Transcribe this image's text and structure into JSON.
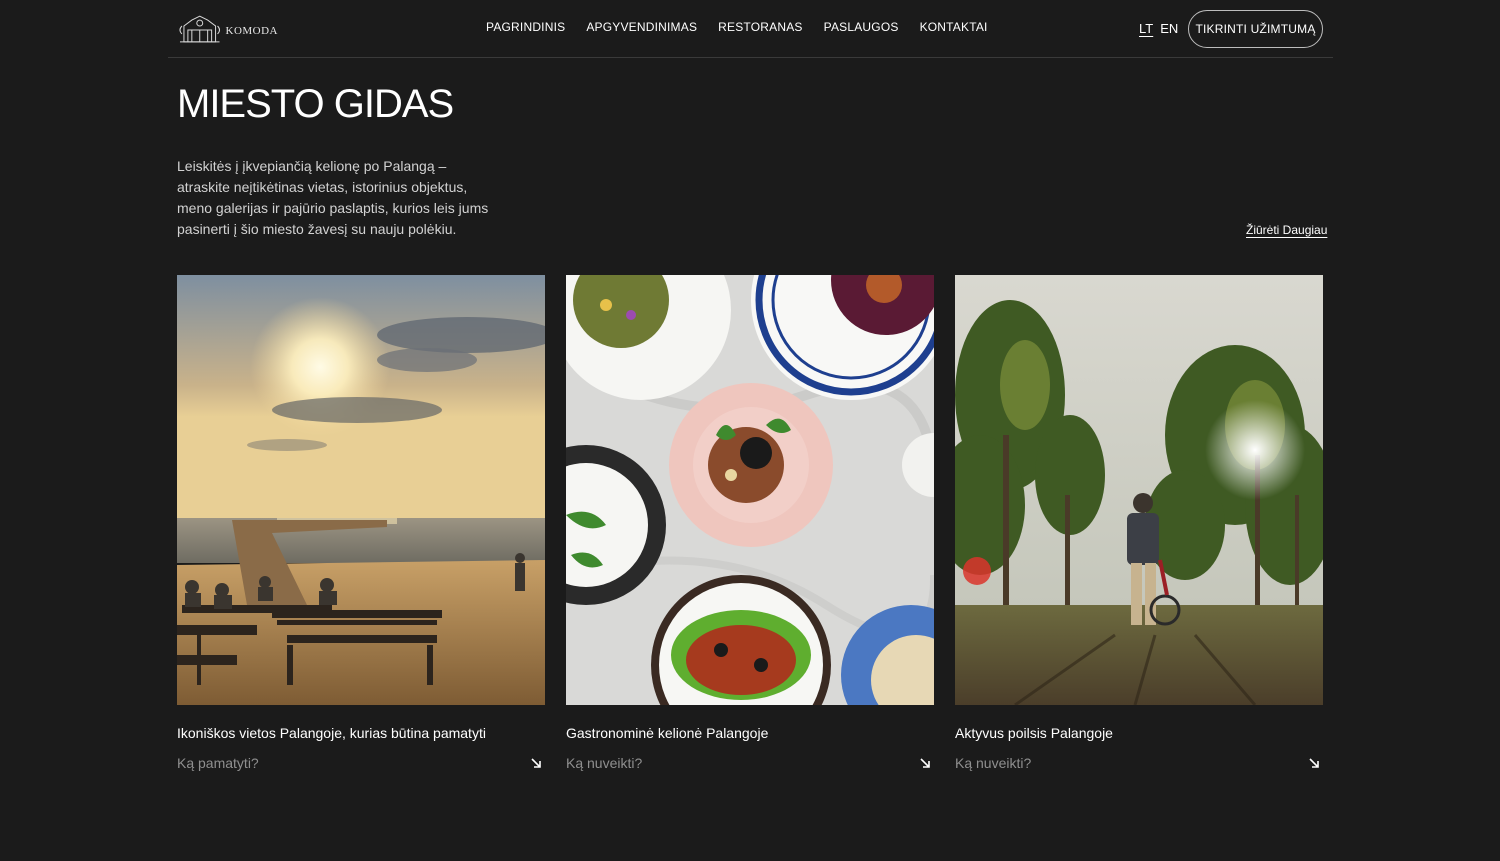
{
  "header": {
    "logo_text": "KOMODA",
    "nav": [
      "PAGRINDINIS",
      "APGYVENDINIMAS",
      "RESTORANAS",
      "PASLAUGOS",
      "KONTAKTAI"
    ],
    "lang": [
      "LT",
      "EN"
    ],
    "cta": "TIKRINTI UŽIMTUMĄ"
  },
  "main": {
    "title": "MIESTO GIDAS",
    "intro": "Leiskitės į įkvepiančią kelionę po Palangą – atraskite neįtikėtinas vietas, istorinius objektus, meno galerijas ir pajūrio paslaptis, kurios leis jums pasinerti į šio miesto žavesį su nauju polėkiu.",
    "see_more": "Žiūrėti Daugiau"
  },
  "cards": [
    {
      "title": "Ikoniškos vietos Palangoje, kurias būtina pamatyti",
      "link": "Ką pamatyti?"
    },
    {
      "title": "Gastronominė kelionė Palangoje",
      "link": "Ką nuveikti?"
    },
    {
      "title": "Aktyvus poilsis Palangoje",
      "link": "Ką nuveikti?"
    }
  ]
}
